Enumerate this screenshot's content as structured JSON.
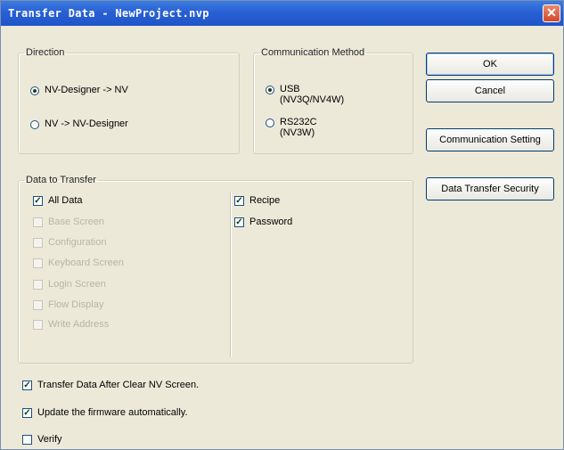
{
  "window": {
    "title": "Transfer Data - NewProject.nvp",
    "close_glyph": "✕"
  },
  "direction": {
    "legend": "Direction",
    "options": [
      {
        "label": "NV-Designer -> NV",
        "selected": true
      },
      {
        "label": "NV -> NV-Designer",
        "selected": false
      }
    ]
  },
  "communication": {
    "legend": "Communication Method",
    "options": [
      {
        "line1": "USB",
        "line2": "(NV3Q/NV4W)",
        "selected": true
      },
      {
        "line1": "RS232C",
        "line2": "(NV3W)",
        "selected": false
      }
    ]
  },
  "data_to_transfer": {
    "legend": "Data to Transfer",
    "left": [
      {
        "label": "All Data",
        "checked": true,
        "enabled": true
      },
      {
        "label": "Base Screen",
        "checked": false,
        "enabled": false
      },
      {
        "label": "Configuration",
        "checked": false,
        "enabled": false
      },
      {
        "label": "Keyboard Screen",
        "checked": false,
        "enabled": false
      },
      {
        "label": "Login Screen",
        "checked": false,
        "enabled": false
      },
      {
        "label": "Flow Display",
        "checked": false,
        "enabled": false
      },
      {
        "label": "Write Address",
        "checked": false,
        "enabled": false
      }
    ],
    "right": [
      {
        "label": "Recipe",
        "checked": true,
        "enabled": true
      },
      {
        "label": "Password",
        "checked": true,
        "enabled": true
      }
    ]
  },
  "buttons": {
    "ok": "OK",
    "cancel": "Cancel",
    "communication_setting": "Communication Setting",
    "data_transfer_security": "Data Transfer Security"
  },
  "options": [
    {
      "label": "Transfer Data After Clear NV Screen.",
      "checked": true
    },
    {
      "label": "Update the firmware automatically.",
      "checked": true
    },
    {
      "label": "Verify",
      "checked": false
    }
  ],
  "colors": {
    "titlebar": "#2860d4",
    "dialog_bg": "#ece9d8",
    "close_button": "#d1492a"
  }
}
